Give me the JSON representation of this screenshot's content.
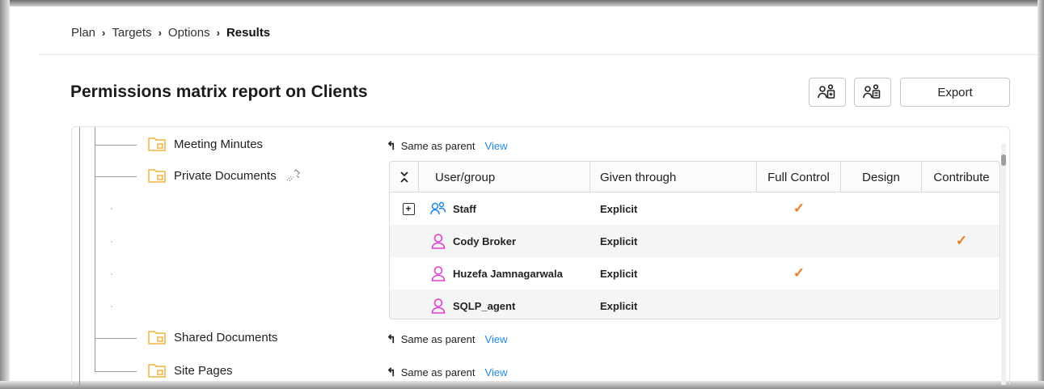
{
  "breadcrumb": {
    "items": [
      "Plan",
      "Targets",
      "Options"
    ],
    "current": "Results",
    "separator": "›"
  },
  "page": {
    "title": "Permissions matrix report on Clients"
  },
  "toolbar": {
    "icon_button_1": "add-user-group-icon",
    "icon_button_2": "user-group-list-icon",
    "export_label": "Export"
  },
  "tree": {
    "items": [
      {
        "label": "Meeting Minutes",
        "status": "Same as parent",
        "link": "View"
      },
      {
        "label": "Private Documents",
        "icon_extra": "broken-inheritance-icon"
      },
      {
        "label": "Shared Documents",
        "status": "Same as parent",
        "link": "View"
      },
      {
        "label": "Site Pages",
        "status": "Same as parent",
        "link": "View"
      }
    ]
  },
  "permissions_table": {
    "columns": [
      "User/group",
      "Given through",
      "Full Control",
      "Design",
      "Contribute"
    ],
    "rows": [
      {
        "name": "Staff",
        "type": "group",
        "given_through": "Explicit",
        "full_control": true,
        "design": false,
        "contribute": false,
        "expandable": true
      },
      {
        "name": "Cody Broker",
        "type": "user",
        "given_through": "Explicit",
        "full_control": false,
        "design": false,
        "contribute": true
      },
      {
        "name": "Huzefa Jamnagarwala",
        "type": "user",
        "given_through": "Explicit",
        "full_control": true,
        "design": false,
        "contribute": false
      },
      {
        "name": "SQLP_agent",
        "type": "user",
        "given_through": "Explicit",
        "full_control": false,
        "design": false,
        "contribute": false
      }
    ],
    "check_glyph": "✓",
    "expand_glyph": "+"
  },
  "colors": {
    "accent_link": "#1e88e5",
    "check": "#f07c1e",
    "user_icon": "#e040d0",
    "group_icon": "#1e88e5",
    "folder": "#f2b33d"
  }
}
